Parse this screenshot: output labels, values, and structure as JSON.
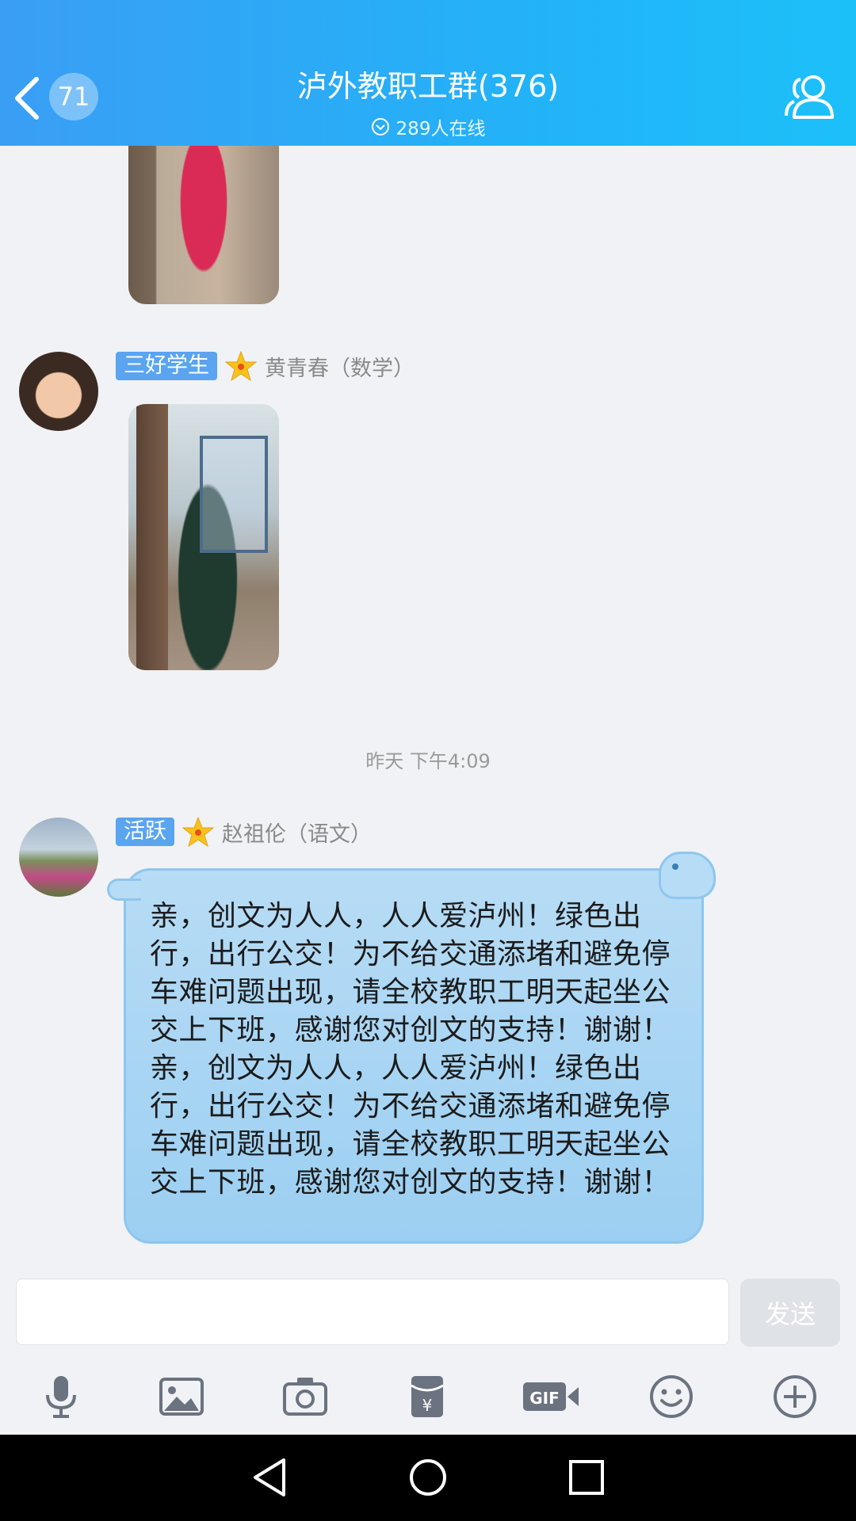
{
  "header": {
    "back_badge": "71",
    "title": "泸外教职工群(376)",
    "online": "289人在线"
  },
  "messages": [
    {
      "badge": "三好学生",
      "sender": "黄青春（数学）",
      "type": "image"
    },
    {
      "timestamp": "昨天 下午4:09"
    },
    {
      "badge": "活跃",
      "sender": "赵祖伦（语文）",
      "type": "text",
      "text": "亲，创文为人人，人人爱泸州！绿色出行，出行公交！为不给交通添堵和避免停车难问题出现，请全校教职工明天起坐公交上下班，感谢您对创文的支持！谢谢！亲，创文为人人，人人爱泸州！绿色出行，出行公交！为不给交通添堵和避免停车难问题出现，请全校教职工明天起坐公交上下班，感谢您对创文的支持！谢谢！"
    }
  ],
  "input": {
    "value": "",
    "send_label": "发送"
  },
  "toolbar": [
    "microphone-icon",
    "image-icon",
    "camera-icon",
    "red-packet-icon",
    "gif-icon",
    "emoji-icon",
    "plus-icon"
  ],
  "colors": {
    "header_start": "#3a9ef5",
    "header_end": "#1cc0f9",
    "bubble": "#a9d6f4",
    "badge": "#5aa4f0"
  }
}
